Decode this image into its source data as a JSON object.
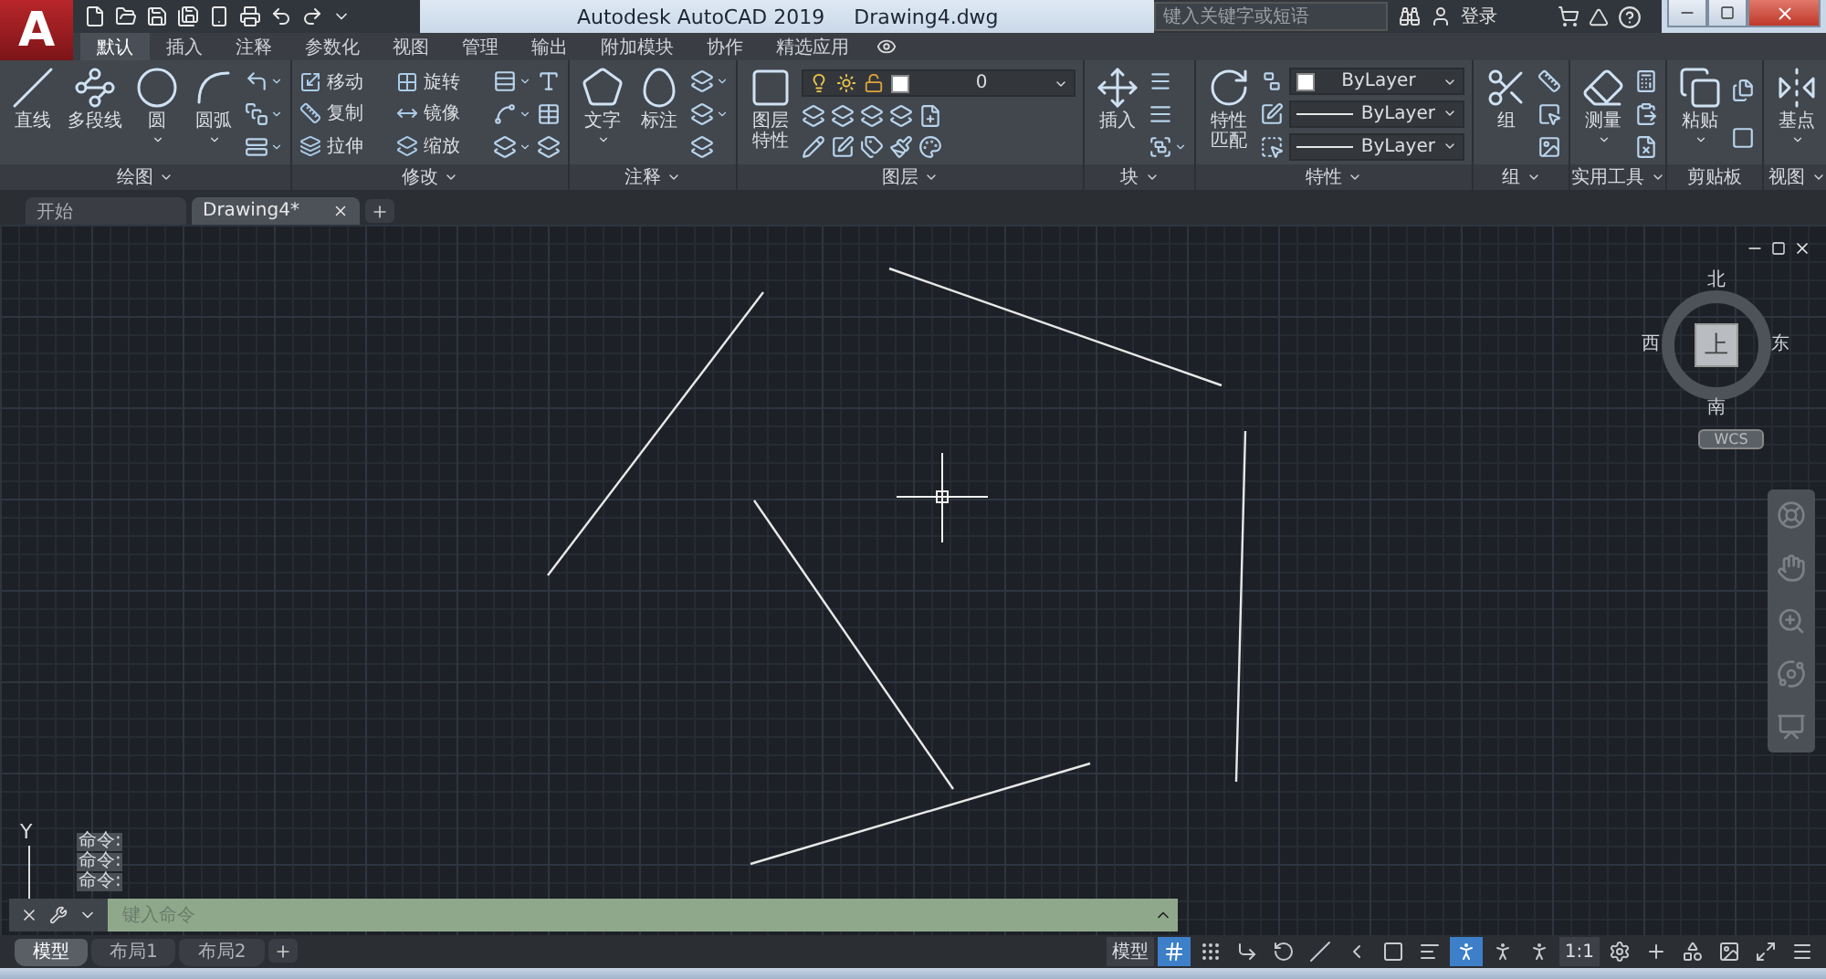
{
  "logo": "A",
  "title": {
    "app": "Autodesk AutoCAD 2019",
    "document": "Drawing4.dwg"
  },
  "search": {
    "placeholder": "键入关键字或短语"
  },
  "account": {
    "label": "登录"
  },
  "ribbon_tabs": [
    {
      "label": "默认",
      "selected": true
    },
    {
      "label": "插入",
      "selected": false
    },
    {
      "label": "注释",
      "selected": false
    },
    {
      "label": "参数化",
      "selected": false
    },
    {
      "label": "视图",
      "selected": false
    },
    {
      "label": "管理",
      "selected": false
    },
    {
      "label": "输出",
      "selected": false
    },
    {
      "label": "附加模块",
      "selected": false
    },
    {
      "label": "协作",
      "selected": false
    },
    {
      "label": "精选应用",
      "selected": false
    }
  ],
  "panels": [
    {
      "title": "绘图",
      "menu": true,
      "tools": [
        {
          "label": "直线",
          "menu": false
        },
        {
          "label": "多段线",
          "menu": false
        },
        {
          "label": "圆",
          "menu": true
        },
        {
          "label": "圆弧",
          "menu": true
        }
      ],
      "rows": [
        [
          {
            "kind": "icon",
            "menu": true
          }
        ],
        [
          {
            "kind": "icon",
            "menu": true
          }
        ],
        [
          {
            "kind": "icon",
            "menu": true
          }
        ]
      ]
    },
    {
      "title": "修改",
      "menu": true,
      "rows": [
        [
          {
            "kind": "small",
            "label": "移动"
          },
          {
            "kind": "small",
            "label": "旋转"
          },
          {
            "kind": "icon",
            "menu": true
          },
          {
            "kind": "icon",
            "menu": false
          }
        ],
        [
          {
            "kind": "small",
            "label": "复制"
          },
          {
            "kind": "small",
            "label": "镜像"
          },
          {
            "kind": "icon",
            "menu": true
          },
          {
            "kind": "icon",
            "menu": false
          }
        ],
        [
          {
            "kind": "small",
            "label": "拉伸"
          },
          {
            "kind": "small",
            "label": "缩放"
          },
          {
            "kind": "icon",
            "menu": true
          },
          {
            "kind": "icon",
            "menu": false
          }
        ]
      ]
    },
    {
      "title": "注释",
      "menu": true,
      "tools": [
        {
          "label": "文字",
          "menu": true
        },
        {
          "label": "标注",
          "menu": false
        }
      ],
      "rows": [
        [
          {
            "kind": "icon",
            "menu": true
          }
        ],
        [
          {
            "kind": "icon",
            "menu": true
          }
        ],
        [
          {
            "kind": "icon",
            "menu": false
          }
        ]
      ]
    },
    {
      "title": "图层",
      "menu": true,
      "tools": [
        {
          "label": "图层特性",
          "menu": false
        }
      ],
      "rows": [
        [
          {
            "kind": "layer-select",
            "value": "0"
          }
        ],
        [
          {
            "kind": "icon",
            "menu": false
          },
          {
            "kind": "icon",
            "menu": false
          },
          {
            "kind": "icon",
            "menu": false
          },
          {
            "kind": "icon",
            "menu": false
          },
          {
            "kind": "icon",
            "menu": false
          }
        ],
        [
          {
            "kind": "icon",
            "menu": false
          },
          {
            "kind": "icon",
            "menu": false
          },
          {
            "kind": "icon",
            "menu": false
          },
          {
            "kind": "icon",
            "menu": false
          },
          {
            "kind": "icon",
            "menu": false
          }
        ]
      ]
    },
    {
      "title": "块",
      "menu": true,
      "tools": [
        {
          "label": "插入",
          "menu": false
        }
      ],
      "rows": [
        [
          {
            "kind": "icon",
            "menu": false
          }
        ],
        [
          {
            "kind": "icon",
            "menu": false
          }
        ],
        [
          {
            "kind": "icon",
            "menu": true
          }
        ]
      ]
    },
    {
      "title": "特性",
      "menu": true,
      "tools": [
        {
          "label": "特性匹配",
          "menu": false
        }
      ],
      "rows": [
        [
          {
            "kind": "icon",
            "menu": false
          },
          {
            "kind": "color-select",
            "value": "ByLayer"
          }
        ],
        [
          {
            "kind": "icon",
            "menu": false
          },
          {
            "kind": "line-select",
            "value": "ByLayer"
          }
        ],
        [
          {
            "kind": "icon",
            "menu": false
          },
          {
            "kind": "line-select",
            "value": "ByLayer"
          }
        ]
      ]
    },
    {
      "title": "组",
      "menu": true,
      "tools": [
        {
          "label": "组",
          "menu": false
        }
      ],
      "rows": [
        [
          {
            "kind": "icon",
            "menu": false
          }
        ],
        [
          {
            "kind": "icon",
            "menu": false
          }
        ],
        [
          {
            "kind": "icon",
            "menu": false
          }
        ]
      ]
    },
    {
      "title": "实用工具",
      "menu": true,
      "tools": [
        {
          "label": "测量",
          "menu": true
        }
      ],
      "rows": [
        [
          {
            "kind": "icon",
            "menu": false
          }
        ],
        [
          {
            "kind": "icon",
            "menu": false
          }
        ],
        [
          {
            "kind": "icon",
            "menu": false
          }
        ]
      ]
    },
    {
      "title": "剪贴板",
      "menu": false,
      "tools": [
        {
          "label": "粘贴",
          "menu": true
        }
      ],
      "rows": [
        [
          {
            "kind": "icon",
            "menu": false
          }
        ],
        [
          {
            "kind": "icon",
            "menu": false
          }
        ]
      ]
    },
    {
      "title": "视图",
      "menu": true,
      "tools": [
        {
          "label": "基点",
          "menu": true
        }
      ]
    }
  ],
  "file_tabs": [
    {
      "label": "开始",
      "selected": false
    },
    {
      "label": "Drawing4*",
      "selected": true
    }
  ],
  "viewcube": {
    "face": "上",
    "north": "北",
    "south": "南",
    "east": "东",
    "west": "西",
    "coordinate_system": "WCS"
  },
  "ucs": {
    "y_axis": "Y"
  },
  "command_history": [
    "命令:",
    "命令:",
    "命令:"
  ],
  "command_line": {
    "placeholder": "键入命令"
  },
  "layout_tabs": [
    {
      "label": "模型",
      "selected": true
    },
    {
      "label": "布局1",
      "selected": false
    },
    {
      "label": "布局2",
      "selected": false
    }
  ],
  "status_bar": [
    {
      "kind": "text",
      "label": "模型"
    },
    {
      "kind": "toggle",
      "on": true
    },
    {
      "kind": "toggle",
      "on": false
    },
    {
      "kind": "toggle",
      "on": false
    },
    {
      "kind": "toggle",
      "on": false
    },
    {
      "kind": "toggle",
      "on": false
    },
    {
      "kind": "toggle",
      "on": false
    },
    {
      "kind": "toggle",
      "on": false
    },
    {
      "kind": "toggle",
      "on": false
    },
    {
      "kind": "toggle",
      "on": true
    },
    {
      "kind": "toggle",
      "on": false
    },
    {
      "kind": "toggle",
      "on": false
    },
    {
      "kind": "text",
      "label": "1:1"
    },
    {
      "kind": "toggle",
      "on": false
    },
    {
      "kind": "toggle",
      "on": false
    },
    {
      "kind": "toggle",
      "on": false
    },
    {
      "kind": "toggle",
      "on": false
    },
    {
      "kind": "toggle",
      "on": false
    },
    {
      "kind": "toggle",
      "on": false
    }
  ]
}
